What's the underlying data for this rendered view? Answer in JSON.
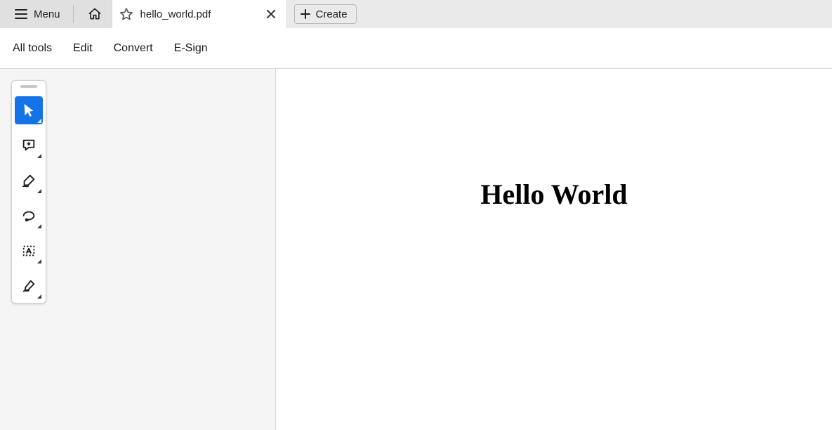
{
  "titlebar": {
    "menu_label": "Menu",
    "tab_title": "hello_world.pdf",
    "create_label": "Create"
  },
  "menubar": {
    "items": [
      "All tools",
      "Edit",
      "Convert",
      "E-Sign"
    ]
  },
  "toolbox": {
    "tools": [
      {
        "name": "select-tool",
        "active": true
      },
      {
        "name": "comment-tool",
        "active": false
      },
      {
        "name": "highlight-tool",
        "active": false
      },
      {
        "name": "draw-tool",
        "active": false
      },
      {
        "name": "text-box-tool",
        "active": false
      },
      {
        "name": "sign-tool",
        "active": false
      }
    ]
  },
  "document": {
    "content": "Hello World"
  }
}
